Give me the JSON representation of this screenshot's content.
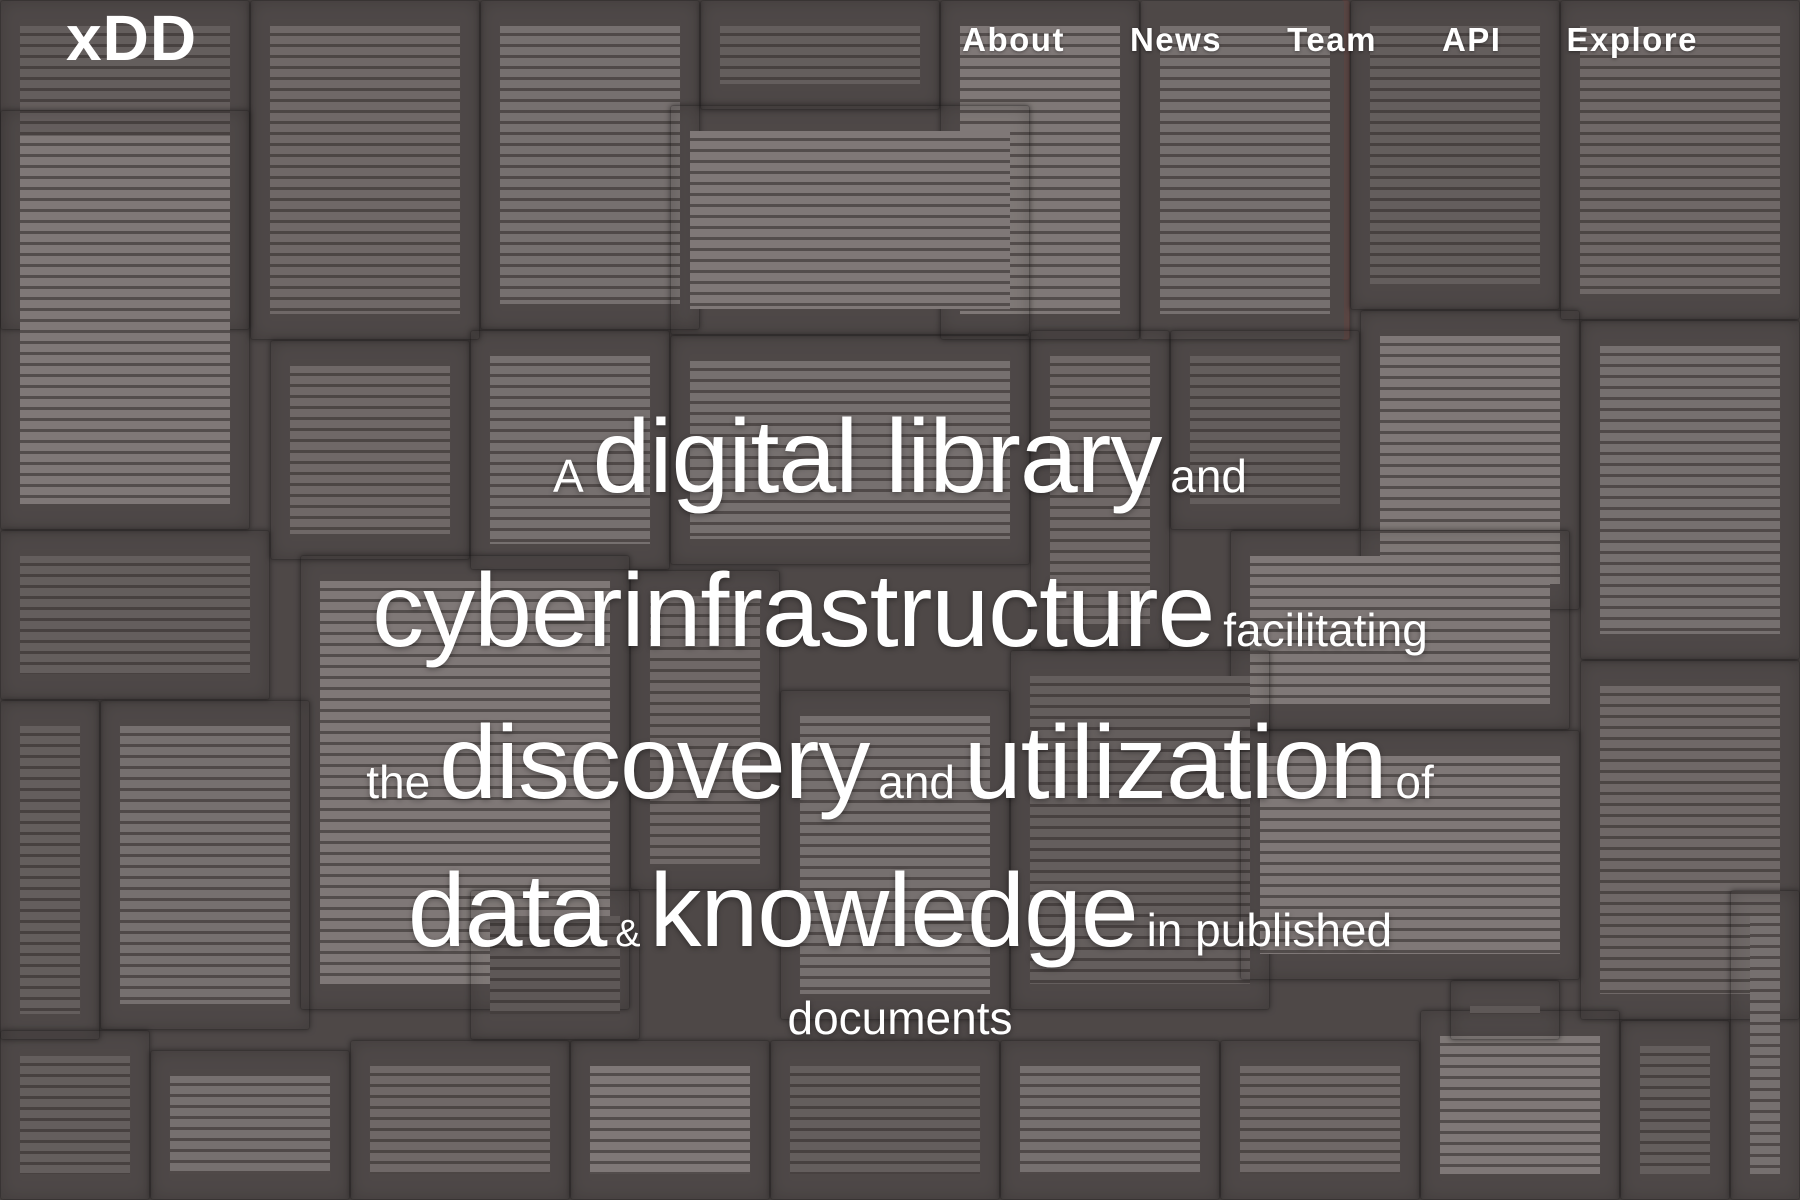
{
  "navbar": {
    "logo": "xDD",
    "links": [
      "About",
      "News",
      "Team",
      "API",
      "Explore"
    ]
  },
  "hero": {
    "background": "open-books-photo",
    "headline": {
      "line1": [
        "A",
        "digital library",
        "and"
      ],
      "line2": [
        "cyberinfrastructure",
        "facilitating"
      ],
      "line3": [
        "the",
        "discovery",
        "and",
        "utilization",
        "of"
      ],
      "line4": [
        "data",
        "&",
        "knowledge",
        "in published"
      ],
      "line5": [
        "documents"
      ]
    }
  },
  "colors": {
    "text": "#ffffff",
    "overlay": "#3c3837"
  }
}
